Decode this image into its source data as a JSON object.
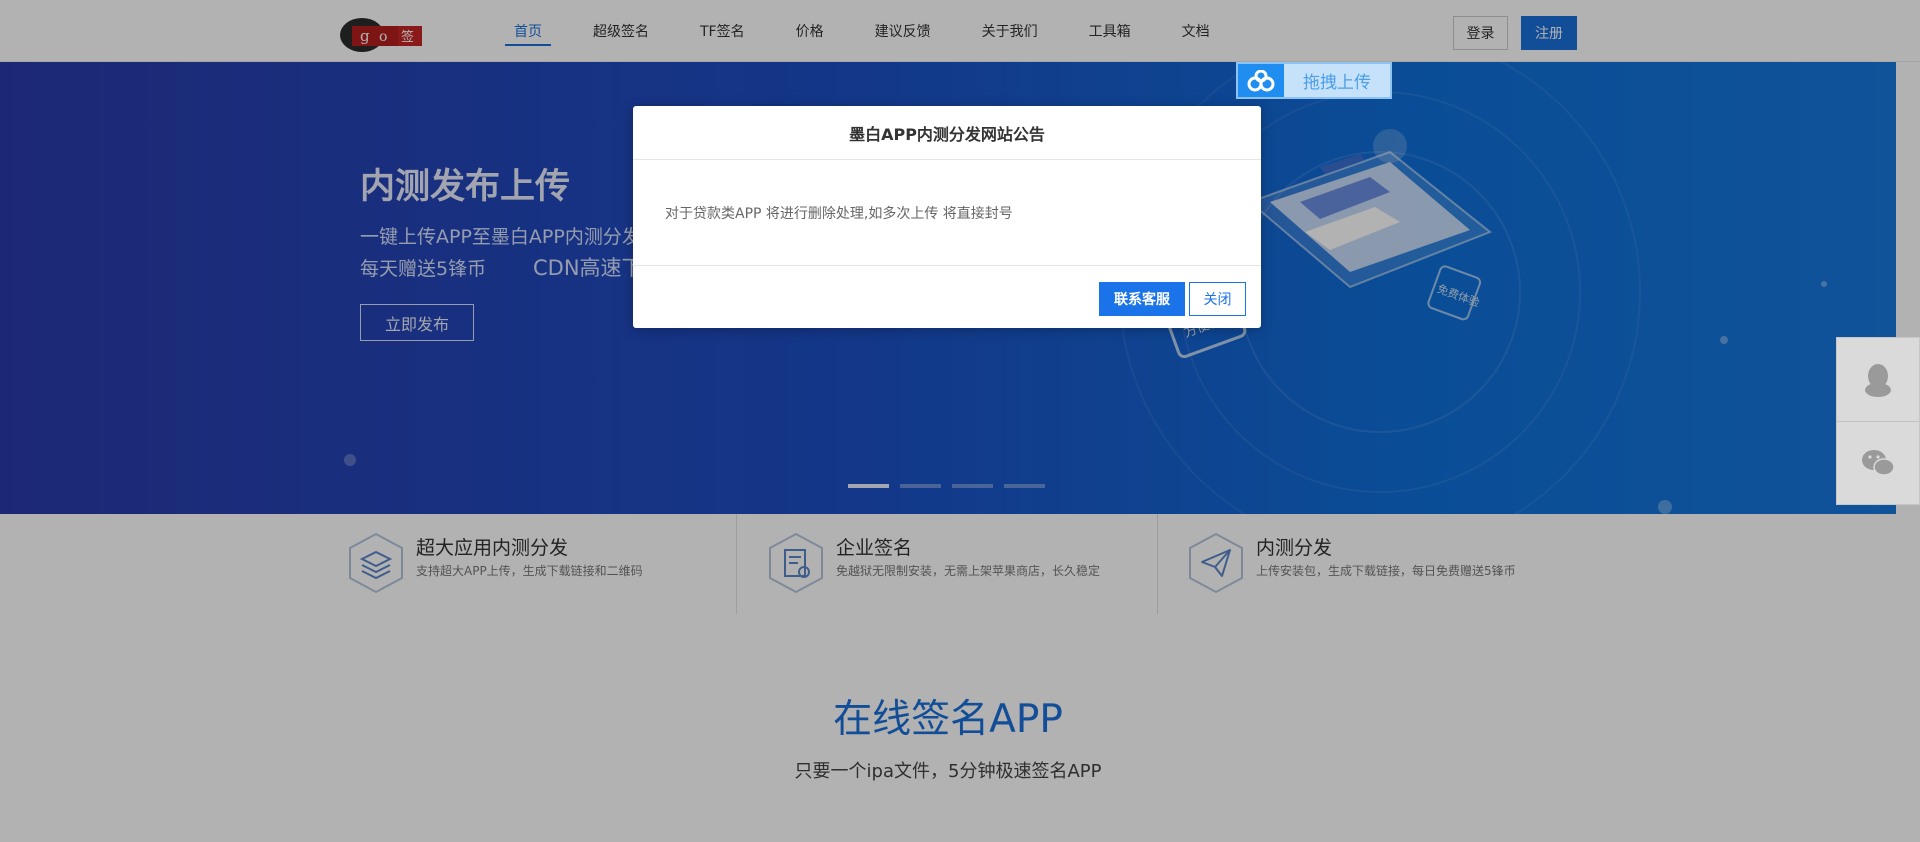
{
  "header": {
    "logo_alt": "go签",
    "nav": [
      "首页",
      "超级签名",
      "TF签名",
      "价格",
      "建议反馈",
      "关于我们",
      "工具箱",
      "文档"
    ],
    "login_label": "登录",
    "register_label": "注册"
  },
  "banner": {
    "title": "内测发布上传",
    "line1": "一键上传APP至墨白APP内测分发",
    "line2": "每天赠送5锋币",
    "line2b": "CDN高速下",
    "button_label": "立即发布",
    "slide_count": 4,
    "active_slide": 1,
    "illustration_labels": [
      "方便快捷",
      "免费体验"
    ]
  },
  "features": [
    {
      "title": "超大应用内测分发",
      "desc": "支持超大APP上传，生成下载链接和二维码",
      "icon": "layers-icon"
    },
    {
      "title": "企业签名",
      "desc": "免越狱无限制安装，无需上架苹果商店，长久稳定",
      "icon": "certificate-icon"
    },
    {
      "title": "内测分发",
      "desc": "上传安装包，生成下载链接，每日免费赠送5锋币",
      "icon": "paper-plane-icon"
    }
  ],
  "section": {
    "title": "在线签名APP",
    "subtitle": "只要一个ipa文件，5分钟极速签名APP"
  },
  "upload_badge": {
    "label": "拖拽上传",
    "icon": "baidu-cloud-icon"
  },
  "side_float": {
    "items": [
      "qq-icon",
      "wechat-icon"
    ]
  },
  "modal": {
    "title": "墨白APP内测分发网站公告",
    "message": "对于贷款类APP 将进行删除处理,如多次上传 将直接封号",
    "contact_label": "联系客服",
    "close_label": "关闭"
  },
  "colors": {
    "accent": "#1a6fd8",
    "banner_start": "#2a3aa8",
    "banner_end": "#1777dc"
  }
}
